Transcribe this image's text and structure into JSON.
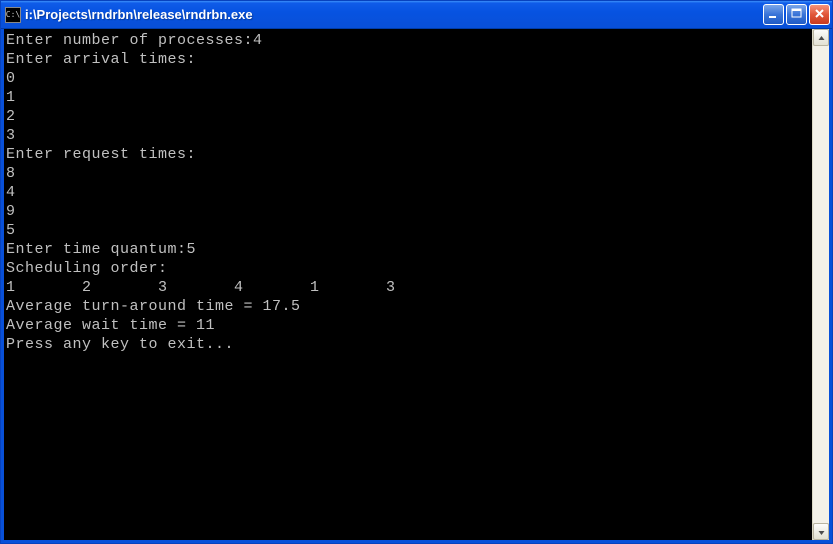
{
  "window": {
    "title": "i:\\Projects\\rndrbn\\release\\rndrbn.exe",
    "icon_text": "C:\\"
  },
  "console": {
    "lines": [
      "Enter number of processes:4",
      "Enter arrival times:",
      "0",
      "1",
      "2",
      "3",
      "Enter request times:",
      "8",
      "4",
      "9",
      "5",
      "Enter time quantum:5",
      "Scheduling order:",
      "1       2       3       4       1       3",
      "Average turn-around time = 17.5",
      "Average wait time = 11",
      "Press any key to exit..."
    ]
  }
}
